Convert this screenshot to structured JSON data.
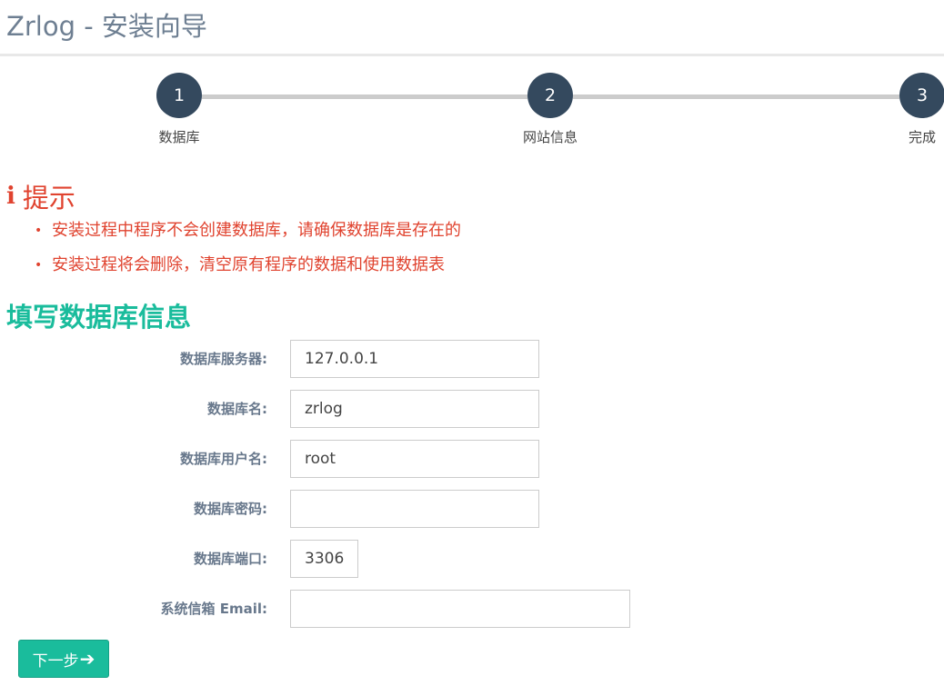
{
  "header": {
    "title": "Zrlog - 安装向导"
  },
  "stepper": {
    "steps": [
      {
        "number": "1",
        "label": "数据库"
      },
      {
        "number": "2",
        "label": "网站信息"
      },
      {
        "number": "3",
        "label": "完成"
      }
    ]
  },
  "tips": {
    "icon": "info-icon",
    "icon_glyph": "i",
    "title": "提示",
    "color": "#e0432f",
    "items": [
      "安装过程中程序不会创建数据库，请确保数据库是存在的",
      "安装过程将会删除，清空原有程序的数据和使用数据表"
    ]
  },
  "form": {
    "title": "填写数据库信息",
    "accent": "#1abc9c",
    "fields": [
      {
        "label": "数据库服务器:",
        "value": "127.0.0.1"
      },
      {
        "label": "数据库名:",
        "value": "zrlog"
      },
      {
        "label": "数据库用户名:",
        "value": "root"
      },
      {
        "label": "数据库密码:",
        "value": ""
      },
      {
        "label": "数据库端口:",
        "value": "3306"
      },
      {
        "label": "系统信箱 Email:",
        "value": ""
      }
    ],
    "next_button": {
      "label": "下一步",
      "icon": "arrow-right-icon",
      "icon_glyph": "➔"
    }
  }
}
